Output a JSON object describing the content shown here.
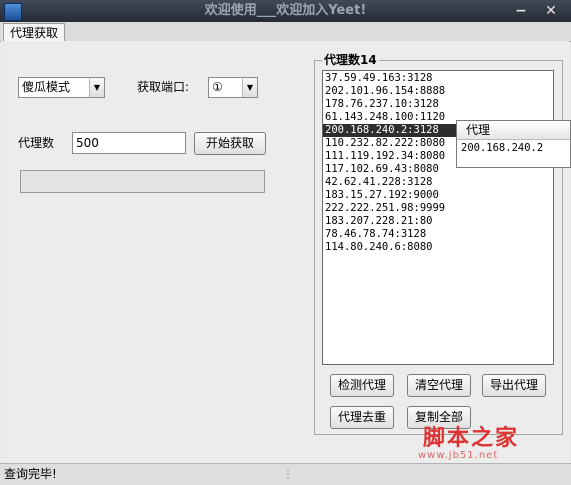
{
  "window": {
    "title": "欢迎使用___欢迎加入Yeet!",
    "minimize_glyph": "−",
    "close_glyph": "✕"
  },
  "tabs": [
    {
      "label": "代理获取",
      "selected": true
    }
  ],
  "controls": {
    "mode_select": {
      "value": "傻瓜模式"
    },
    "port_label": "获取端口:",
    "port_select": {
      "value": "①"
    },
    "proxy_count_label": "代理数",
    "proxy_count_value": "500",
    "start_button": "开始获取",
    "progress": {
      "value": 0
    }
  },
  "proxy_panel": {
    "title": "代理数14",
    "items": [
      "37.59.49.163:3128",
      "202.101.96.154:8888",
      "178.76.237.10:3128",
      "61.143.248.100:1120",
      "200.168.240.2:3128",
      "110.232.82.222:8080",
      "111.119.192.34:8080",
      "117.102.69.43:8080",
      "42.62.41.228:3128",
      "183.15.27.192:9000",
      "222.222.251.98:9999",
      "183.207.228.21:80",
      "78.46.78.74:3128",
      "114.80.240.6:8080"
    ],
    "selected_index": 4,
    "buttons": {
      "check": "检测代理",
      "clear": "清空代理",
      "export": "导出代理",
      "dedupe": "代理去重",
      "copy_all": "复制全部"
    }
  },
  "popup": {
    "header": "代理",
    "value": "200.168.240.2"
  },
  "status": {
    "text": "查询完毕!",
    "grip": "⋮"
  },
  "watermark": {
    "text": "脚本之家",
    "url": "www.jb51.net"
  },
  "colors": {
    "selection": "#2e2e2e",
    "titlebar": "#333a44",
    "watermark": "#dd3333"
  }
}
